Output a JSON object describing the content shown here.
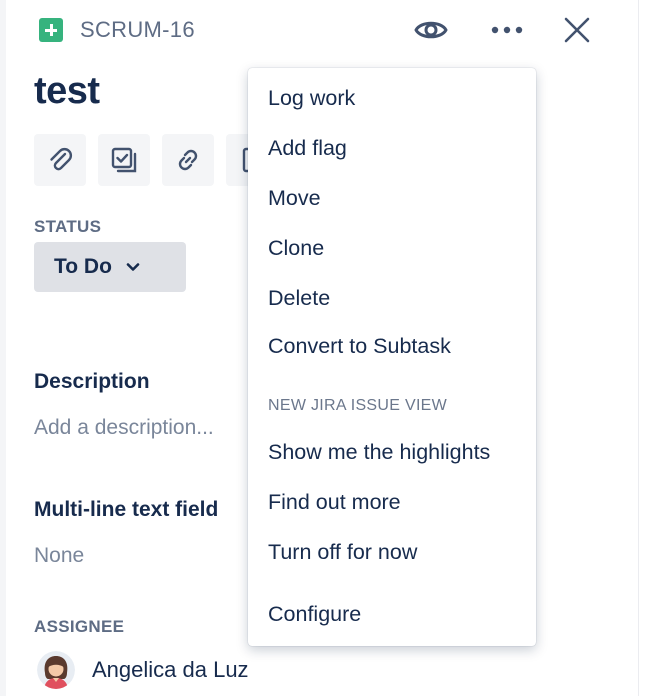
{
  "header": {
    "issue_type_icon": "story-add-icon",
    "issue_key": "SCRUM-16",
    "watch_icon": "eye-icon",
    "more_icon": "more-horizontal-icon",
    "close_icon": "close-icon"
  },
  "issue": {
    "title": "test"
  },
  "toolbar": {
    "buttons": [
      {
        "name": "attach",
        "icon": "paperclip-icon"
      },
      {
        "name": "subtask",
        "icon": "subtask-icon"
      },
      {
        "name": "link",
        "icon": "link-icon"
      },
      {
        "name": "page",
        "icon": "page-icon"
      }
    ]
  },
  "status": {
    "label": "STATUS",
    "value": "To Do",
    "icon": "chevron-down-icon"
  },
  "description": {
    "label": "Description",
    "placeholder": "Add a description..."
  },
  "multiline_field": {
    "label": "Multi-line text field",
    "value": "None"
  },
  "assignee": {
    "label": "ASSIGNEE",
    "name": "Angelica da Luz",
    "avatar_icon": "avatar-icon"
  },
  "menu": {
    "items": [
      {
        "label": "Log work"
      },
      {
        "label": "Add flag"
      },
      {
        "label": "Move"
      },
      {
        "label": "Clone"
      },
      {
        "label": "Delete"
      },
      {
        "label": "Convert to Subtask"
      }
    ],
    "group_label": "NEW JIRA ISSUE VIEW",
    "group_items": [
      {
        "label": "Show me the highlights"
      },
      {
        "label": "Find out more"
      },
      {
        "label": "Turn off for now"
      }
    ],
    "footer_item": {
      "label": "Configure"
    }
  },
  "colors": {
    "issue_type_green": "#36b37e",
    "text_primary": "#172b4d",
    "text_subtle": "#5e6c84",
    "placeholder": "#7a869a",
    "status_bg": "#dfe1e6"
  }
}
